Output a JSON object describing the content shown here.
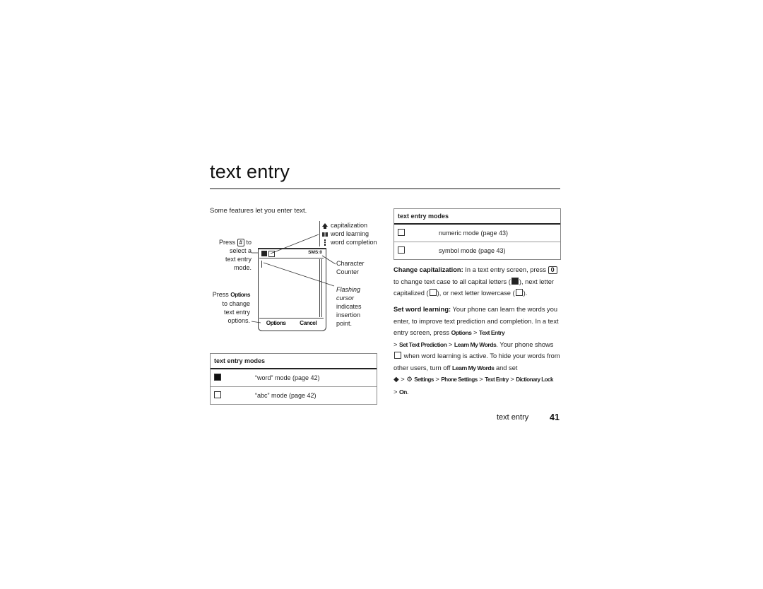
{
  "page": {
    "title": "text entry",
    "intro": "Some features let you enter text.",
    "footer": {
      "section": "text entry",
      "page_number": "41"
    }
  },
  "diagram": {
    "legend": [
      {
        "icon": "capitalization-icon",
        "label": "capitalization"
      },
      {
        "icon": "word-learning-icon",
        "label": "word learning"
      },
      {
        "icon": "word-completion-icon",
        "label": "word completion"
      }
    ],
    "press_key_pre": "Press",
    "press_key": "#",
    "press_key_post": "to",
    "select_lines": [
      "select a",
      "text entry",
      "mode."
    ],
    "press_options_pre": "Press",
    "press_options_key": "Options",
    "options_lines": [
      "to change",
      "text entry",
      "options."
    ],
    "status_counter": "SMS:0",
    "softkey_left": "Options",
    "softkey_right": "Cancel",
    "character_counter": [
      "Character",
      "Counter"
    ],
    "cursor_lines_italic": [
      "Flashing",
      "cursor"
    ],
    "cursor_lines": [
      "indicates",
      "insertion",
      "point."
    ]
  },
  "table_left": {
    "header": "text entry modes",
    "rows": [
      {
        "icon": "word-mode-icon",
        "label": "“word” mode (page 42)"
      },
      {
        "icon": "abc-mode-icon",
        "label": "“abc” mode (page 42)"
      }
    ]
  },
  "table_right": {
    "header": "text entry modes",
    "rows": [
      {
        "icon": "numeric-mode-icon",
        "label": "numeric mode (page 43)"
      },
      {
        "icon": "symbol-mode-icon",
        "label": "symbol mode (page 43)"
      }
    ]
  },
  "capitalization": {
    "heading": "Change capitalization:",
    "t1": " In a text entry screen, press ",
    "key": "0",
    "t2": " to change text case to all capital letters (",
    "t3": "), next letter capitalized (",
    "t4": "), or next letter lowercase (",
    "t5": ")."
  },
  "word_learning": {
    "heading": "Set word learning:",
    "t1": " Your phone can learn the words you enter, to improve text prediction and completion. In a text entry screen, press ",
    "m1": "Options",
    "sep": " > ",
    "m2": "Text Entry",
    "m3": "Set Text Prediction",
    "m4": "Learn My Words",
    "t2": ". Your phone shows ",
    "t3": " when word learning is active. To hide your words from other users, turn off ",
    "m5": "Learn My Words",
    "t4": " and set",
    "p1": "Settings",
    "p2": "Phone Settings",
    "p3": "Text Entry",
    "p4": "Dictionary Lock",
    "p5": "On",
    "end": "."
  }
}
